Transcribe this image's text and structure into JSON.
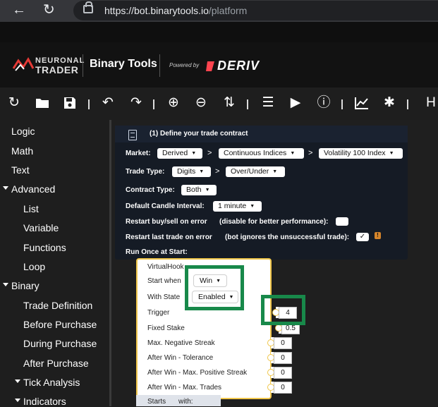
{
  "browser": {
    "url_host": "https://bot.binarytools.io",
    "url_path": "/platform",
    "back_icon": "←",
    "reload_icon": "↻"
  },
  "header": {
    "logo_line1": "NEURONAL",
    "logo_line2": "TRADER",
    "title": "Binary Tools",
    "powered_by": "Powered by",
    "brand": "DERIV"
  },
  "toolbar": {
    "reload": "↻",
    "open": "▬",
    "save": "▣",
    "undo": "↶",
    "redo": "↷",
    "zoom_in": "⊕",
    "zoom_out": "⊖",
    "sort": "⇅",
    "logs": "☰",
    "run": "▶",
    "info": "ⓘ",
    "chart": "📈",
    "indicators": "✱",
    "more": "H"
  },
  "sidebar": {
    "items": [
      {
        "label": "Logic"
      },
      {
        "label": "Math"
      },
      {
        "label": "Text"
      },
      {
        "label": "Advanced"
      },
      {
        "label": "List"
      },
      {
        "label": "Variable"
      },
      {
        "label": "Functions"
      },
      {
        "label": "Loop"
      },
      {
        "label": "Binary"
      },
      {
        "label": "Trade Definition"
      },
      {
        "label": "Before Purchase"
      },
      {
        "label": "During Purchase"
      },
      {
        "label": "After Purchase"
      },
      {
        "label": "Tick Analysis"
      },
      {
        "label": "Indicators"
      }
    ]
  },
  "trade_block": {
    "title": "(1) Define your trade contract",
    "market_label": "Market:",
    "market": "Derived",
    "submarket": "Continuous Indices",
    "symbol": "Volatility 100 Index",
    "trade_type_label": "Trade Type:",
    "trade_type": "Digits",
    "trade_subtype": "Over/Under",
    "contract_type_label": "Contract Type:",
    "contract_type": "Both",
    "candle_label": "Default Candle Interval:",
    "candle": "1 minute",
    "restart_error_label": "Restart buy/sell on error",
    "restart_error_hint": "(disable for better performance):",
    "restart_last_label": "Restart last trade on error",
    "restart_last_hint": "(bot ignores the unsuccessful trade):",
    "restart_last_check": "✓",
    "warning_icon": "!",
    "run_once_label": "Run Once at Start:",
    "sep": ">"
  },
  "virtual_hook": {
    "title": "VirtualHook",
    "start_when_label": "Start when",
    "start_when": "Win",
    "with_state_label": "With State",
    "with_state": "Enabled",
    "trigger_label": "Trigger",
    "trigger": "4",
    "fixed_stake_label": "Fixed Stake",
    "fixed_stake": "0.5",
    "max_neg_label": "Max. Negative Streak",
    "max_neg": "0",
    "tolerance_label": "After Win - Tolerance",
    "tolerance": "0",
    "max_pos_label": "After Win - Max. Positive Streak",
    "max_pos": "0",
    "max_trades_label": "After Win - Max. Trades",
    "max_trades": "0",
    "starts_label": "Starts",
    "with_label": "with:"
  }
}
